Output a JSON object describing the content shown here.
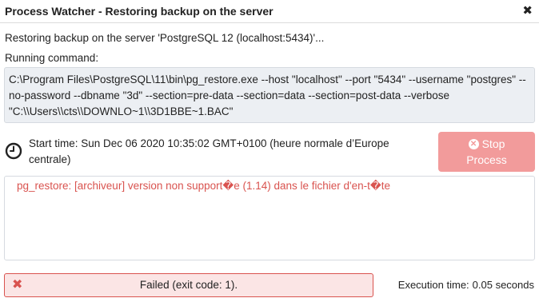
{
  "window": {
    "title": "Process Watcher - Restoring backup on the server",
    "close_glyph": "✖"
  },
  "status_line": "Restoring backup on the server 'PostgreSQL 12 (localhost:5434)'...",
  "command": {
    "label": "Running command:",
    "text": "C:\\Program Files\\PostgreSQL\\11\\bin\\pg_restore.exe --host \"localhost\" --port \"5434\" --username \"postgres\" --no-password --dbname \"3d\" --section=pre-data --section=data --section=post-data --verbose \"C:\\\\Users\\\\cts\\\\DOWNLO~1\\\\3D1BBE~1.BAC\""
  },
  "start_time": {
    "icon": "clock-icon",
    "text": "Start time: Sun Dec 06 2020 10:35:02 GMT+0100 (heure normale d’Europe centrale)"
  },
  "stop_button": {
    "line1": "Stop",
    "line2": "Process",
    "icon": "close-circle-icon",
    "icon_glyph": "✕",
    "color": "#f29b9b"
  },
  "log": {
    "lines": [
      "pg_restore: [archiveur] version non support�e (1.14) dans le fichier d'en-t�te"
    ],
    "color": "#d9534f"
  },
  "result": {
    "icon": "error-x-icon",
    "icon_glyph": "✖",
    "text": "Failed (exit code: 1).",
    "color": "#d9534f"
  },
  "execution_time": {
    "label": "Execution time:",
    "value": "0.05 seconds"
  }
}
